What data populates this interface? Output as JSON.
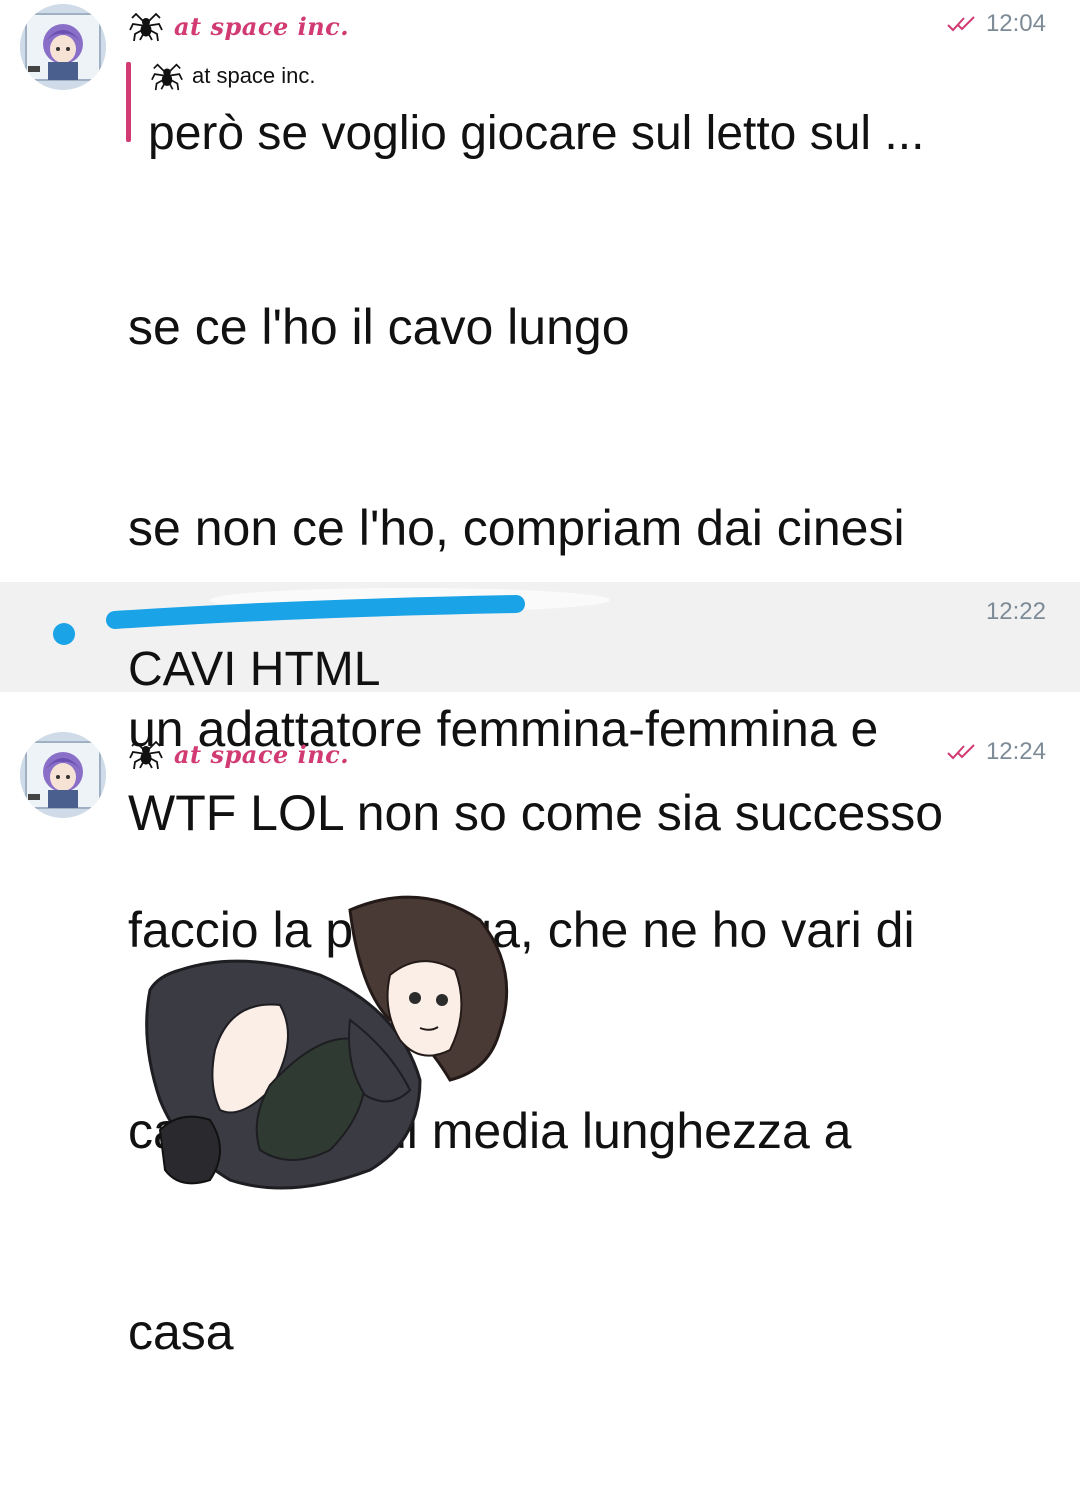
{
  "messages": [
    {
      "sender": "at space inc.",
      "time": "12:04",
      "reply": {
        "sender": "at space inc.",
        "text": "però se voglio giocare sul letto sul ..."
      },
      "lines": [
        "se ce l'ho il cavo lungo",
        "se non ce l'ho, compriam dai cinesi",
        "un adattatore femmina-femmina e",
        "faccio la prolunga, che ne ho vari di",
        "cavi HTML di media lunghezza a",
        "casa"
      ]
    },
    {
      "time": "12:22",
      "text": "CAVI HTML"
    },
    {
      "sender": "at space inc.",
      "time": "12:24",
      "text": "WTF LOL non so come sia successo"
    }
  ],
  "colors": {
    "sender_name": "#d13a72",
    "time": "#7d8b97",
    "check": "#d13a72",
    "redaction": "#1aa3e6",
    "highlight_band": "#f1f1f1"
  },
  "icons": [
    "spider-icon",
    "double-check-icon",
    "avatar",
    "sticker-image"
  ]
}
